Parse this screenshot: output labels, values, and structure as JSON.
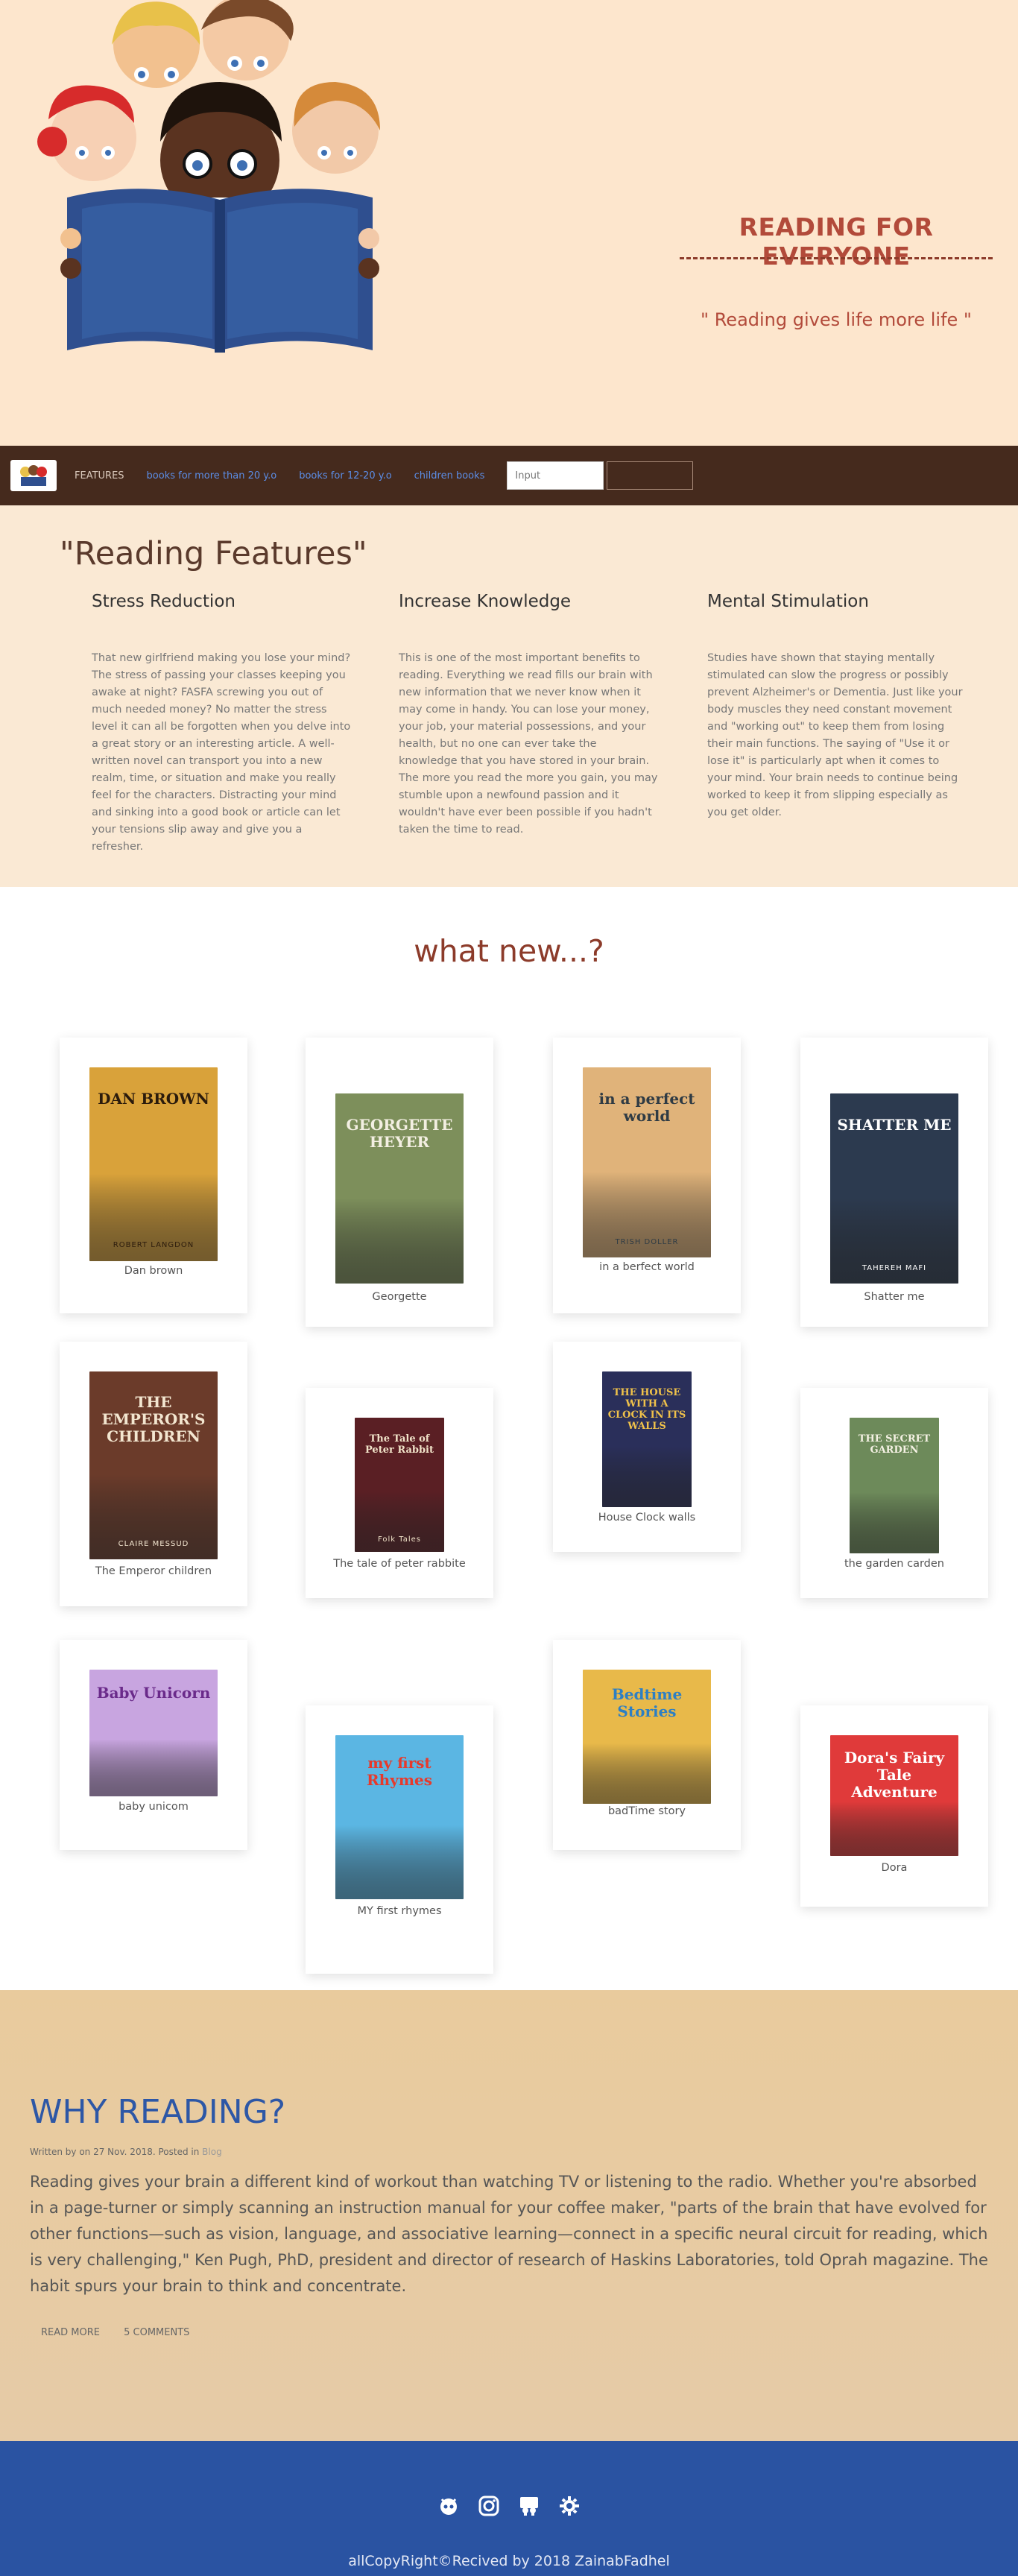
{
  "hero": {
    "title": "READING FOR EVERYONE",
    "quote": "\" Reading gives life more life \""
  },
  "nav": {
    "features": "FEATURES",
    "link1": "books for more than 20 y.o",
    "link2": "books for 12-20 y.o",
    "link3": "children books",
    "search_placeholder": "Input",
    "search_button": ""
  },
  "features": {
    "title": "\"Reading Features\"",
    "items": [
      {
        "heading": "Stress Reduction",
        "text": "That new girlfriend making you lose your mind? The stress of passing your classes keeping you awake at night? FASFA screwing you out of much needed money? No matter the stress level it can all be forgotten when you delve into a great story or an interesting article. A well-written novel can transport you into a new realm, time, or situation and make you really feel for the characters. Distracting your mind and sinking into a good book or article can let your tensions slip away and give you a refresher."
      },
      {
        "heading": "Increase Knowledge",
        "text": "This is one of the most important benefits to reading. Everything we read fills our brain with new information that we never know when it may come in handy. You can lose your money, your job, your material possessions, and your health, but no one can ever take the knowledge that you have stored in your brain. The more you read the more you gain, you may stumble upon a newfound passion and it wouldn't have ever been possible if you hadn't taken the time to read."
      },
      {
        "heading": "Mental Stimulation",
        "text": "Studies have shown that staying mentally stimulated can slow the progress or possibly prevent Alzheimer's or Dementia. Just like your body muscles they need constant movement and \"working out\" to keep them from losing their main functions. The saying of \"Use it or lose it\" is particularly apt when it comes to your mind. Your brain needs to continue being worked to keep it from slipping especially as you get older."
      }
    ]
  },
  "whatnew": {
    "title": "what new...?",
    "books": [
      {
        "title": "Dan brown",
        "cover_text": "DAN BROWN",
        "cover_sub": "ROBERT LANGDON",
        "bg": "#d9a23a",
        "fg": "#2b1b0c"
      },
      {
        "title": "Georgette",
        "cover_text": "GEORGETTE HEYER",
        "cover_sub": "",
        "bg": "#7d8f5b",
        "fg": "#f3efe2"
      },
      {
        "title": "in a berfect world",
        "cover_text": "in a perfect world",
        "cover_sub": "TRISH DOLLER",
        "bg": "#e0b37a",
        "fg": "#2f3b44"
      },
      {
        "title": "Shatter me",
        "cover_text": "SHATTER ME",
        "cover_sub": "TAHEREH MAFI",
        "bg": "#2c3a4f",
        "fg": "#ffffff"
      },
      {
        "title": "The Emperor children",
        "cover_text": "THE EMPEROR'S CHILDREN",
        "cover_sub": "CLAIRE MESSUD",
        "bg": "#6b3b2a",
        "fg": "#f3e6d0"
      },
      {
        "title": "The tale of peter rabbite",
        "cover_text": "The Tale of Peter Rabbit",
        "cover_sub": "Folk Tales",
        "bg": "#5a1f24",
        "fg": "#f0e2c8"
      },
      {
        "title": "House Clock walls",
        "cover_text": "THE HOUSE WITH A CLOCK IN ITS WALLS",
        "cover_sub": "",
        "bg": "#2a2f5a",
        "fg": "#f0c24a"
      },
      {
        "title": "the garden carden",
        "cover_text": "THE SECRET GARDEN",
        "cover_sub": "",
        "bg": "#6d8a5a",
        "fg": "#f4f1e3"
      },
      {
        "title": "baby unicom",
        "cover_text": "Baby Unicorn",
        "cover_sub": "",
        "bg": "#c8a5e0",
        "fg": "#6a2a8a"
      },
      {
        "title": "MY first rhymes",
        "cover_text": "my first Rhymes",
        "cover_sub": "",
        "bg": "#5bb6e3",
        "fg": "#e7392b"
      },
      {
        "title": "badTime story",
        "cover_text": "Bedtime Stories",
        "cover_sub": "",
        "bg": "#e8b94a",
        "fg": "#2d7fc4"
      },
      {
        "title": "Dora",
        "cover_text": "Dora's Fairy Tale Adventure",
        "cover_sub": "",
        "bg": "#e03a3a",
        "fg": "#ffffff"
      }
    ]
  },
  "why": {
    "title": "WHY READING?",
    "meta_prefix": "Written by on 27 Nov. 2018. Posted in ",
    "meta_blog": "Blog",
    "body": "Reading gives your brain a different kind of workout than watching TV or listening to the radio. Whether you're absorbed in a page-turner or simply scanning an instruction manual for your coffee maker, \"parts of the brain that have evolved for other functions—such as vision, language, and associative learning—connect in a specific neural circuit for reading, which is very challenging,\" Ken Pugh, PhD, president and director of research of Haskins Laboratories, told Oprah magazine. The habit spurs your brain to think and concentrate.",
    "read_more": "READ MORE",
    "comments": "5 COMMENTS"
  },
  "footer": {
    "copyright": "allCopyRight©Recived by 2018 ZainabFadhel"
  }
}
